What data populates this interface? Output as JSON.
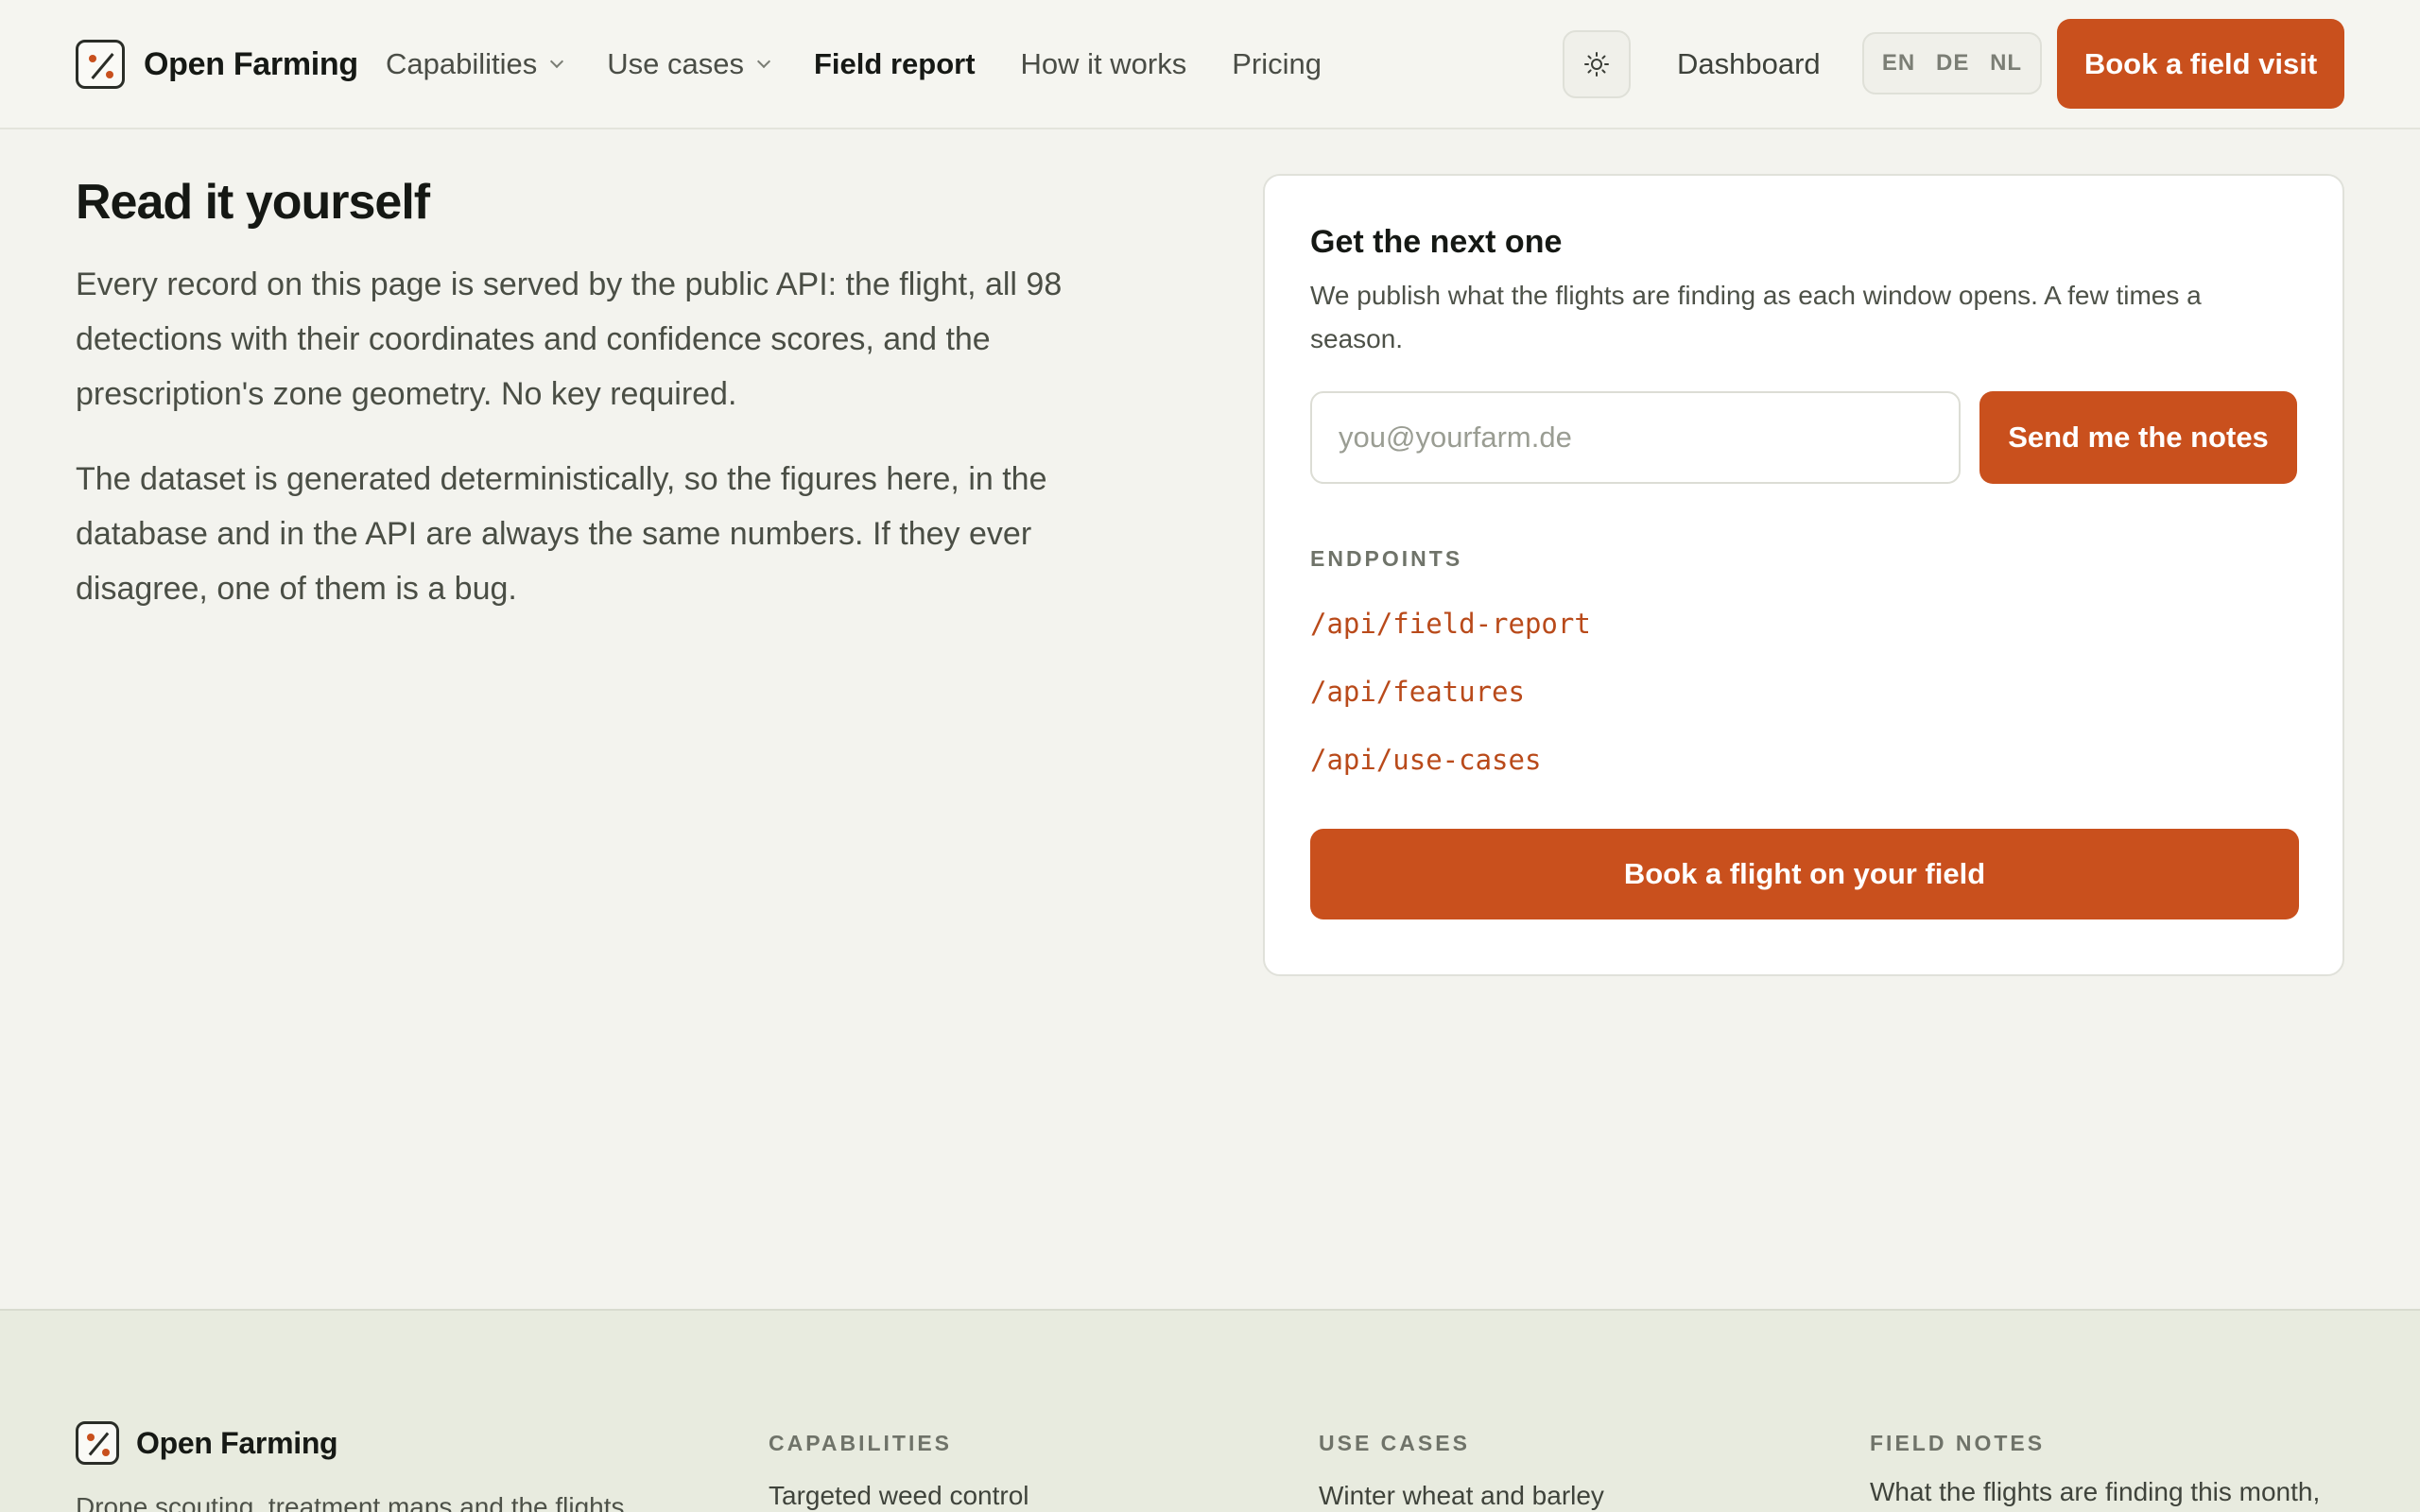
{
  "header": {
    "brand": "Open Farming",
    "nav": [
      {
        "label": "Capabilities",
        "dropdown": true
      },
      {
        "label": "Use cases",
        "dropdown": true
      },
      {
        "label": "Field report",
        "active": true
      },
      {
        "label": "How it works"
      },
      {
        "label": "Pricing"
      }
    ],
    "theme_icon": "sun-icon",
    "dashboard": "Dashboard",
    "languages": [
      "EN",
      "DE",
      "NL"
    ],
    "cta": "Book a field visit"
  },
  "main": {
    "title": "Read it yourself",
    "paragraphs": [
      "Every record on this page is served by the public API: the flight, all 98 detections with their coordinates and confidence scores, and the prescription's zone geometry. No key required.",
      "The dataset is generated deterministically, so the figures here, in the database and in the API are always the same numbers. If they ever disagree, one of them is a bug."
    ]
  },
  "card": {
    "title": "Get the next one",
    "text": "We publish what the flights are finding as each window opens. A few times a season.",
    "email_placeholder": "you@yourfarm.de",
    "send_label": "Send me the notes",
    "endpoints_heading": "ENDPOINTS",
    "endpoints": [
      "/api/field-report",
      "/api/features",
      "/api/use-cases"
    ],
    "book_label": "Book a flight on your field"
  },
  "footer": {
    "brand": "Open Farming",
    "description": "Drone scouting, treatment maps and the flights",
    "columns": [
      {
        "heading": "CAPABILITIES",
        "first": "Targeted weed control"
      },
      {
        "heading": "USE CASES",
        "first": "Winter wheat and barley"
      },
      {
        "heading": "FIELD NOTES",
        "first": "What the flights are finding this month,"
      }
    ]
  },
  "colors": {
    "accent": "#c9501d",
    "background": "#f3f3ee",
    "footer_bg": "#e8ebdf",
    "endpoint_text": "#b94a1a"
  }
}
